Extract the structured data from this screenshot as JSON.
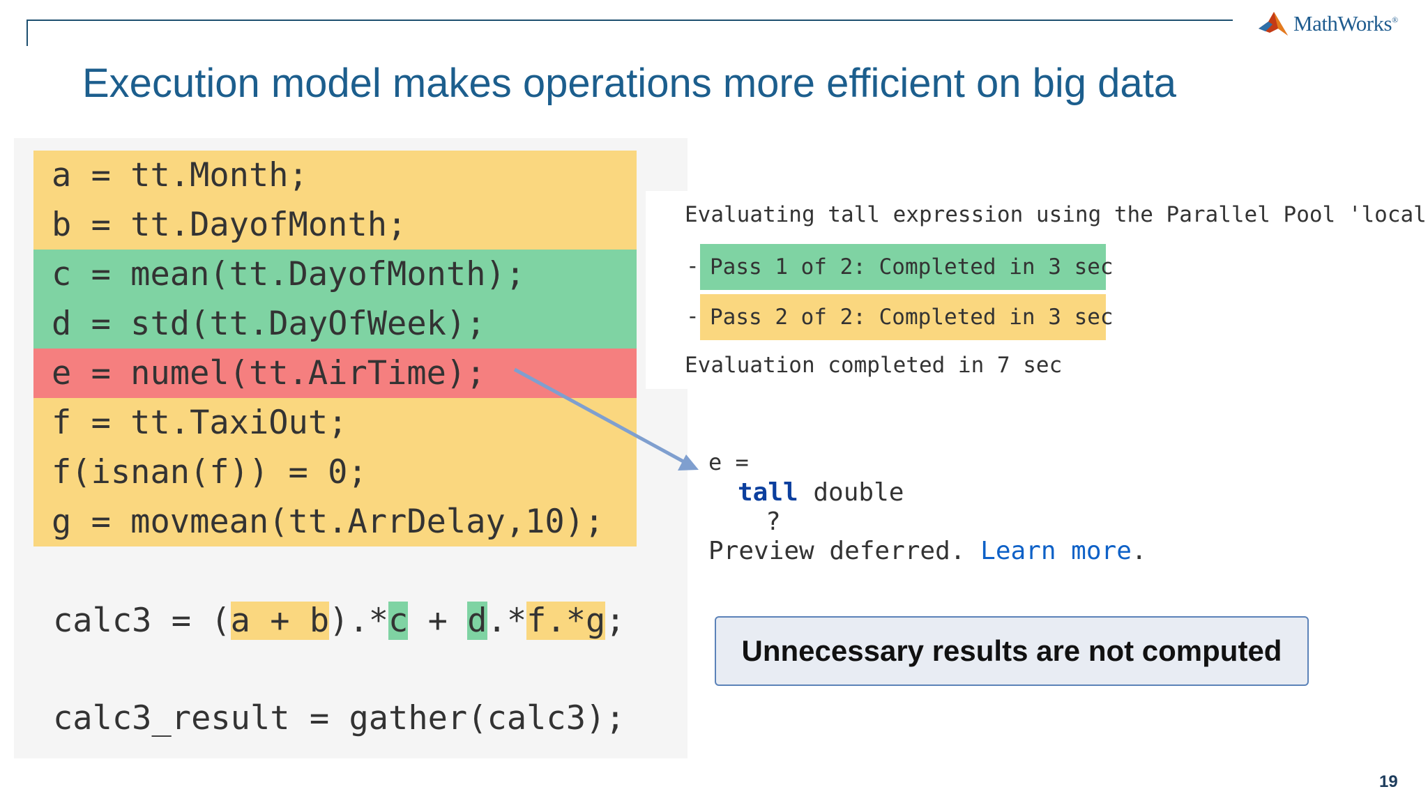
{
  "slide": {
    "title": "Execution model makes operations more efficient on big data",
    "logo_text": "MathWorks",
    "logo_reg": "®",
    "page_number": "19",
    "accent_color": "#1c5e8d"
  },
  "code": {
    "lines": [
      {
        "text": "a = tt.Month;",
        "highlight": "yellow"
      },
      {
        "text": "b = tt.DayofMonth;",
        "highlight": "yellow"
      },
      {
        "text": "c = mean(tt.DayofMonth);",
        "highlight": "green"
      },
      {
        "text": "d = std(tt.DayOfWeek);",
        "highlight": "green"
      },
      {
        "text": "e = numel(tt.AirTime);",
        "highlight": "red"
      },
      {
        "text": "f = tt.TaxiOut;",
        "highlight": "yellow"
      },
      {
        "text": "f(isnan(f)) = 0;",
        "highlight": "yellow"
      },
      {
        "text": "g = movmean(tt.ArrDelay,10);",
        "highlight": "yellow"
      }
    ],
    "calc3": {
      "prefix": "calc3 = (",
      "a_plus_b": "a + b",
      "mid1": ").*",
      "c": "c",
      "mid2": " + ",
      "d": "d",
      "mid3": ".*",
      "f_g": "f.*g",
      "suffix": ";"
    },
    "calc3_result": "calc3_result = gather(calc3);"
  },
  "evaluation": {
    "header": "Evaluating tall expression using the Parallel Pool 'local':",
    "bullet": "-",
    "pass1": "Pass 1 of 2: Completed in 3 sec",
    "pass2": "Pass 2 of 2: Completed in 3 sec",
    "footer": "Evaluation completed in 7 sec"
  },
  "output": {
    "var_line": "e =",
    "tall_keyword": "tall",
    "type": " double",
    "unknown": "?",
    "preview_text": "Preview deferred. ",
    "learn_more": "Learn more",
    "period": "."
  },
  "callout": {
    "text": "Unnecessary results are not computed"
  },
  "colors": {
    "highlight_yellow": "#fad77f",
    "highlight_green": "#7fd3a3",
    "highlight_red": "#f57f7f",
    "arrow": "#7f9fcf"
  }
}
